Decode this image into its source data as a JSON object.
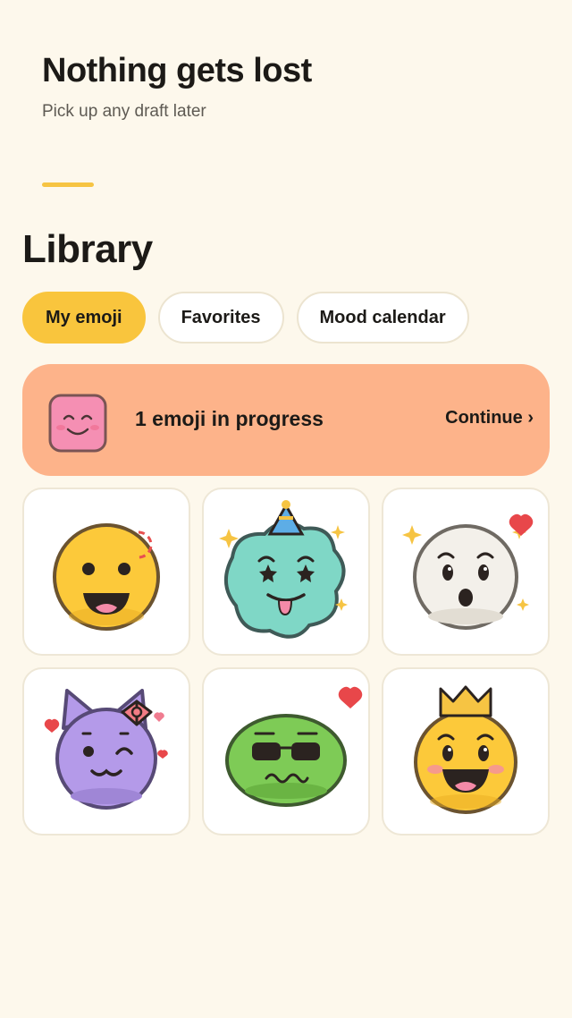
{
  "header": {
    "title": "Nothing gets lost",
    "subtitle": "Pick up any draft later"
  },
  "library": {
    "title": "Library",
    "tabs": [
      {
        "label": "My emoji",
        "active": true
      },
      {
        "label": "Favorites",
        "active": false
      },
      {
        "label": "Mood calendar",
        "active": false
      }
    ],
    "in_progress": {
      "text": "1 emoji in progress",
      "action": "Continue ›"
    },
    "emojis": [
      {
        "name": "yellow-grin-emoji",
        "favorite": false
      },
      {
        "name": "party-star-eyes-emoji",
        "favorite": false
      },
      {
        "name": "surprised-white-emoji",
        "favorite": true
      },
      {
        "name": "purple-cat-wink-emoji",
        "favorite": false
      },
      {
        "name": "green-sunglasses-emoji",
        "favorite": true
      },
      {
        "name": "crown-grin-emoji",
        "favorite": false
      }
    ]
  },
  "colors": {
    "background": "#FDF8EC",
    "accent": "#F9C53D",
    "progress_card": "#FDB38A",
    "heart": "#E8474A"
  }
}
